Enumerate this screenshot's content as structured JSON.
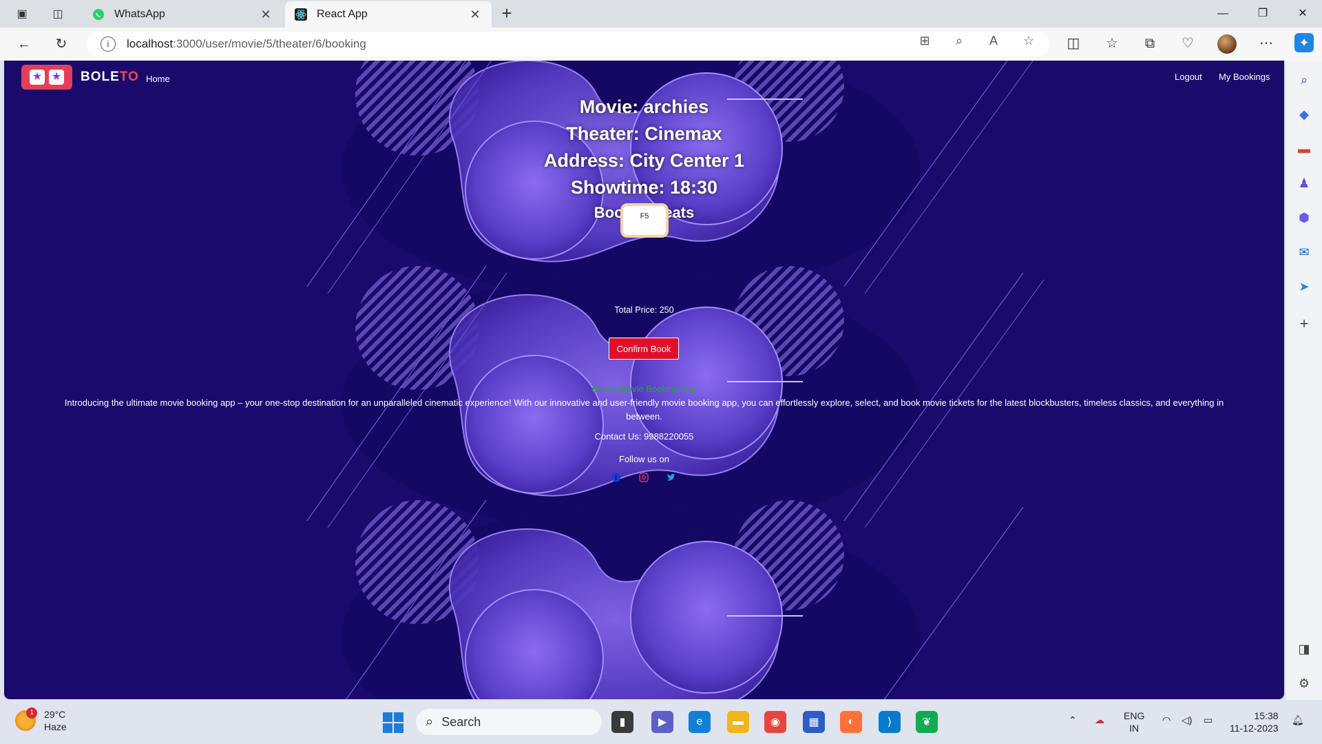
{
  "browser": {
    "tabs": [
      {
        "title": "WhatsApp",
        "favicon": "whatsapp-icon",
        "active": false
      },
      {
        "title": "React App",
        "favicon": "react-icon",
        "active": true
      }
    ],
    "url_host": "localhost",
    "url_path": ":3000/user/movie/5/theater/6/booking"
  },
  "navbar": {
    "brand_prefix": "BOLE",
    "brand_accent": "TO",
    "home": "Home",
    "logout": "Logout",
    "my_bookings": "My Bookings"
  },
  "booking": {
    "movie": "Movie: archies",
    "theater": "Theater: Cinemax",
    "address": "Address: City Center 1",
    "showtime": "Showtime: 18:30",
    "booked_seats_title": "Booked Seats",
    "seats": [
      "F5"
    ],
    "total_price": "Total Price: 250",
    "confirm_label": "Confirm Book"
  },
  "footer": {
    "title": "Boleto Movie Booking App",
    "description": "Introducing the ultimate movie booking app – your one-stop destination for an unparalleled cinematic experience! With our innovative and user-friendly movie booking app, you can effortlessly explore, select, and book movie tickets for the latest blockbusters, timeless classics, and everything in between.",
    "contact": "Contact Us: 9988220055",
    "follow": "Follow us on",
    "socials": [
      "facebook-icon",
      "instagram-icon",
      "twitter-icon"
    ]
  },
  "taskbar": {
    "weather_temp": "29°C",
    "weather_desc": "Haze",
    "weather_badge": "1",
    "search_label": "Search",
    "lang_top": "ENG",
    "lang_bottom": "IN",
    "time": "15:38",
    "date": "11-12-2023"
  },
  "colors": {
    "page_bg": "#1a0a6b",
    "blob": "#6a4fd6",
    "confirm_button": "#e0102a",
    "footer_title": "#1fae2f",
    "brand_accent": "#e94a5b"
  }
}
